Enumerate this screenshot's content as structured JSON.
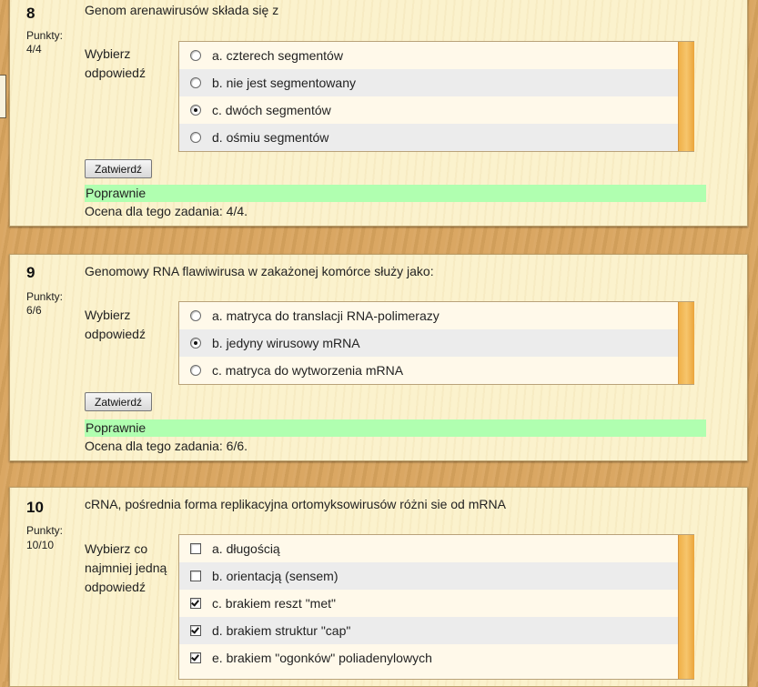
{
  "questions": [
    {
      "number": "8",
      "points_label": "Punkty:",
      "points_value": "4/4",
      "text": "Genom arenawirusów składa się z",
      "prompt": [
        "Wybierz",
        "odpowiedź"
      ],
      "type": "radio",
      "answers": [
        {
          "label": "a. czterech segmentów",
          "checked": false
        },
        {
          "label": "b. nie jest segmentowany",
          "checked": false
        },
        {
          "label": "c. dwóch segmentów",
          "checked": true
        },
        {
          "label": "d. ośmiu segmentów",
          "checked": false
        }
      ],
      "submit_label": "Zatwierdź",
      "feedback": "Poprawnie",
      "grade": "Ocena dla tego zadania: 4/4."
    },
    {
      "number": "9",
      "points_label": "Punkty:",
      "points_value": "6/6",
      "text": "Genomowy RNA flawiwirusa w zakażonej komórce służy jako:",
      "prompt": [
        "Wybierz",
        "odpowiedź"
      ],
      "type": "radio",
      "answers": [
        {
          "label": "a. matryca do translacji RNA-polimerazy",
          "checked": false
        },
        {
          "label": "b. jedyny wirusowy mRNA",
          "checked": true
        },
        {
          "label": "c. matryca do wytworzenia mRNA",
          "checked": false
        }
      ],
      "submit_label": "Zatwierdź",
      "feedback": "Poprawnie",
      "grade": "Ocena dla tego zadania: 6/6."
    },
    {
      "number": "10",
      "points_label": "Punkty:",
      "points_value": "10/10",
      "text": "cRNA, pośrednia forma replikacyjna ortomyksowirusów różni sie od mRNA",
      "prompt": [
        "Wybierz co",
        "najmniej jedną",
        "odpowiedź"
      ],
      "type": "checkbox",
      "answers": [
        {
          "label": "a. długością",
          "checked": false
        },
        {
          "label": "b. orientacją (sensem)",
          "checked": false
        },
        {
          "label": "c. brakiem reszt \"met\"",
          "checked": true
        },
        {
          "label": "d. brakiem struktur \"cap\"",
          "checked": true
        },
        {
          "label": "e. brakiem \"ogonków\" poliadenylowych",
          "checked": true
        }
      ]
    }
  ]
}
